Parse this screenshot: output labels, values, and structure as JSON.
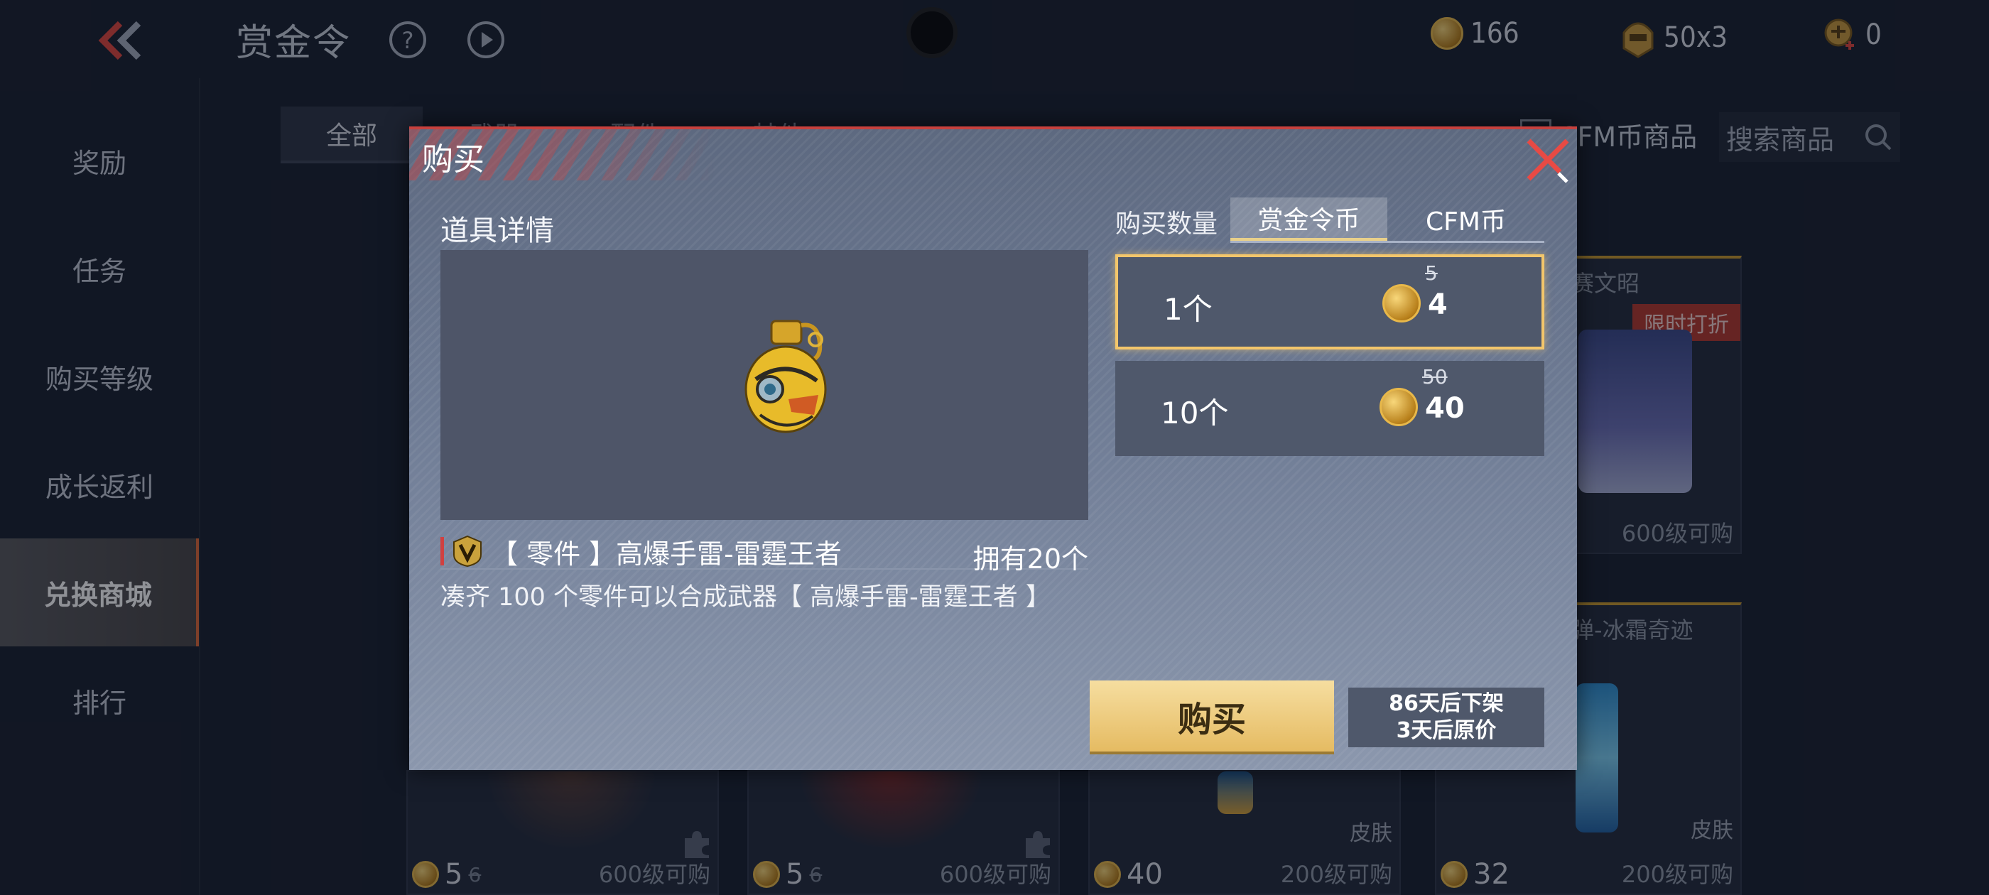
{
  "header": {
    "title": "赏金令",
    "currencies": [
      {
        "icon": "bounty-coin-icon",
        "value": "166"
      },
      {
        "icon": "helmet-token-icon",
        "value": "50x3"
      },
      {
        "icon": "plus-token-icon",
        "value": "0"
      }
    ]
  },
  "sidebar": {
    "items": [
      {
        "label": "奖励"
      },
      {
        "label": "任务"
      },
      {
        "label": "购买等级"
      },
      {
        "label": "成长返利"
      },
      {
        "label": "兑换商城",
        "active": true
      },
      {
        "label": "排行"
      }
    ]
  },
  "shop": {
    "tabs": [
      "全部",
      "武器",
      "配件",
      "其他"
    ],
    "filter_label": "CFM币商品",
    "search_placeholder": "搜索商品",
    "cards": [
      {
        "title": "赛文昭",
        "sale": "限时打折",
        "req": "600级可购"
      },
      {
        "title": "弹-冰霜奇迹",
        "skin": "皮肤",
        "price": "32",
        "req": "200级可购"
      },
      {
        "price": "5",
        "old": "6",
        "req": "600级可购"
      },
      {
        "price": "5",
        "old": "6",
        "req": "600级可购"
      },
      {
        "skin": "皮肤",
        "price": "40",
        "req": "200级可购"
      }
    ]
  },
  "dialog": {
    "title": "购买",
    "detail_title": "道具详情",
    "item_name": "【 零件 】高爆手雷-雷霆王者",
    "owned": "拥有20个",
    "description": "凑齐 100 个零件可以合成武器【 高爆手雷-雷霆王者 】",
    "qty_label": "购买数量",
    "currency_tabs": [
      {
        "label": "赏金令币",
        "active": true
      },
      {
        "label": "CFM币",
        "active": false
      }
    ],
    "options": [
      {
        "count": "1个",
        "old_price": "5",
        "price": "4",
        "selected": true
      },
      {
        "count": "10个",
        "old_price": "50",
        "price": "40",
        "selected": false
      }
    ],
    "buy_label": "购买",
    "expiry_line1": "86天后下架",
    "expiry_line2": "3天后原价"
  },
  "colors": {
    "accent_red": "#c7413e",
    "gold": "#f3c66b",
    "buy_button": "#e5bb62"
  }
}
